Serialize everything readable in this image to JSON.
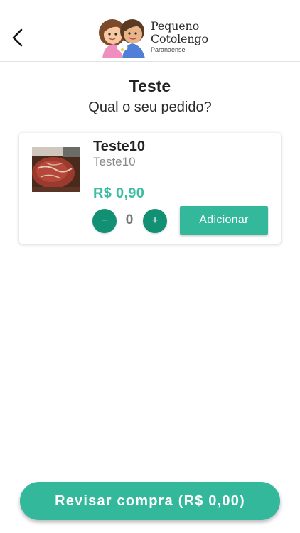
{
  "header": {
    "back_icon": "chevron-left-icon",
    "logo": {
      "line1": "Pequeno",
      "line2": "Cotolengo",
      "line3": "Paranaense"
    }
  },
  "page": {
    "title": "Teste",
    "subtitle": "Qual o seu pedido?"
  },
  "products": [
    {
      "name": "Teste10",
      "description": "Teste10",
      "price": "R$ 0,90",
      "quantity": "0",
      "minus_label": "−",
      "plus_label": "+",
      "add_label": "Adicionar"
    }
  ],
  "footer": {
    "review_label": "Revisar compra (R$ 0,00)"
  },
  "colors": {
    "accent": "#33b89b",
    "price": "#3dbca2",
    "qty_button": "#119074"
  }
}
